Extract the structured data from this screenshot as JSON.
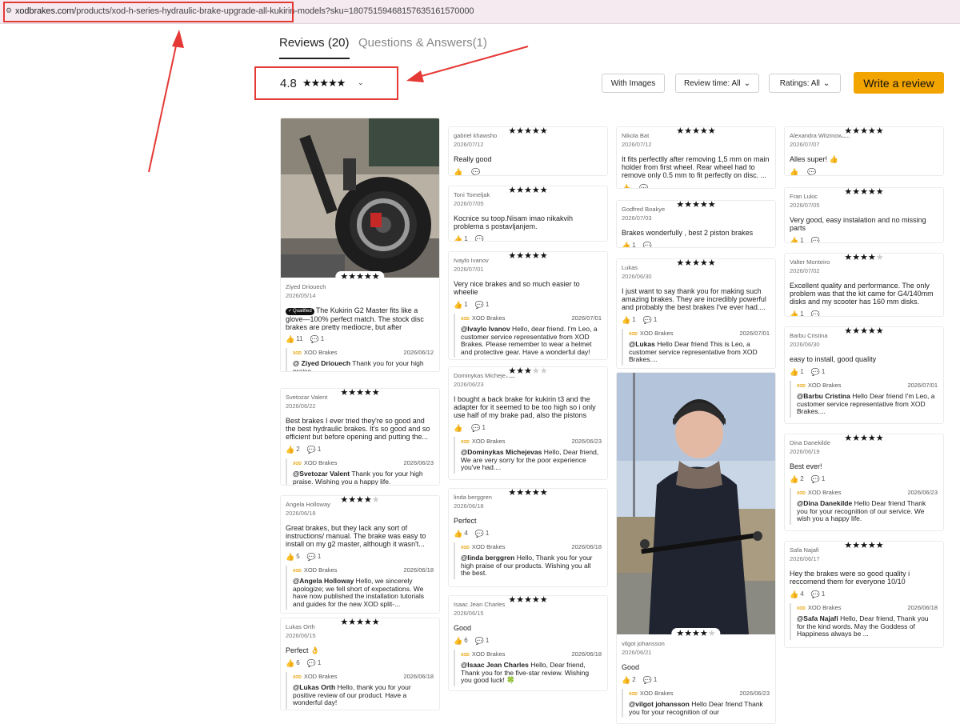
{
  "address_bar": {
    "domain": "xodbrakes.com",
    "path": "/products/xod-h-series-hydraulic-brake-upgrade-all-kukirin-models?sku=18075159468157635161570000"
  },
  "tabs": [
    {
      "label": "Reviews (20)",
      "active": true
    },
    {
      "label": "Questions & Answers(1)",
      "active": false
    }
  ],
  "rating": {
    "value": "4.8",
    "stars": 5,
    "chevron": "⌄"
  },
  "filters": {
    "with_images": "With Images",
    "review_time": "Review time: All",
    "ratings": "Ratings: All",
    "write_review": "Write a review"
  },
  "icons": {
    "star": "★",
    "thumb": "👍",
    "comment": "💬",
    "chevron": "⌄"
  },
  "brand_reply_name": "XOD Brakes",
  "columns": [
    {
      "cards": [
        {
          "stars": 5,
          "photo": "scooter-wheel-photo",
          "name": "Ziyed Driouech",
          "date": "2026/05/14",
          "qualified": "Qualified",
          "text": "The Kukirin G2 Master fits like a glove—100% perfect match. The stock disc brakes are pretty mediocre, but after upgradi...",
          "likes": "11",
          "comments": "1",
          "reply": {
            "date": "2026/06/12",
            "to": "@ Ziyed Driouech",
            "text": " Thank you for your high praise."
          }
        },
        {
          "stars": 5,
          "name": "Svetozar Valent",
          "date": "2026/06/22",
          "text": "Best brakes I ever tried they're so good and the best hydraulic brakes. It's so good and so efficient but before opening and putting the...",
          "likes": "2",
          "comments": "1",
          "reply": {
            "date": "2026/06/23",
            "to": "@Svetozar Valent",
            "text": " Thank you for your high praise. Wishing you a happy life."
          }
        },
        {
          "stars": 4,
          "name": "Angela Holloway",
          "date": "2026/06/18",
          "text": "Great brakes, but they lack any sort of instructions/ manual. The brake was easy to install on my g2 master, although it wasn't...",
          "likes": "5",
          "comments": "1",
          "reply": {
            "date": "2026/06/18",
            "to": "@Angela Holloway",
            "text": " Hello, we sincerely apologize; we fell short of expectations. We have now published the installation tutorials and guides for the new XOD split-..."
          }
        },
        {
          "stars": 5,
          "name": "Lukas Orth",
          "date": "2026/06/15",
          "text": "Perfect 👌",
          "likes": "6",
          "comments": "1",
          "reply": {
            "date": "2026/06/18",
            "to": "@Lukas Orth",
            "text": " Hello, thank you for your positive review of our product. Have a wonderful day!"
          }
        }
      ]
    },
    {
      "cards": [
        {
          "stars": 5,
          "name": "gabriel khawsho",
          "date": "2026/07/12",
          "text": "Really good",
          "likes": "",
          "comments": ""
        },
        {
          "stars": 5,
          "name": "Toni Tomeljak",
          "date": "2026/07/05",
          "text": "Kocnice su toop.Nisam imao nikakvih problema s postavljanjem.",
          "likes": "1",
          "comments": ""
        },
        {
          "stars": 5,
          "name": "Ivaylo Ivanov",
          "date": "2026/07/01",
          "text": "Very nice brakes and so much easier to wheelie",
          "likes": "1",
          "comments": "1",
          "reply": {
            "date": "2026/07/01",
            "to": "@Ivaylo Ivanov",
            "text": " Hello, dear friend. I'm Leo, a customer service representative from XOD Brakes. Please remember to wear a helmet and protective gear. Have a wonderful day!"
          }
        },
        {
          "stars": 3,
          "name": "Dominykas Michejevas",
          "date": "2026/06/23",
          "text": "I bought a back brake for kukirin t3 and the adapter for it seemed to be too high so i only use half of my brake pad, also the pistons ge...",
          "likes": "",
          "comments": "1",
          "reply": {
            "date": "2026/06/23",
            "to": "@Dominykas Michejevas",
            "text": " Hello, Dear friend, We are very sorry for the poor experience you've had...."
          }
        },
        {
          "stars": 5,
          "name": "linda berggren",
          "date": "2026/06/18",
          "text": "Perfect",
          "likes": "4",
          "comments": "1",
          "reply": {
            "date": "2026/06/18",
            "to": "@linda berggren",
            "text": " Hello, Thank you for your high praise of our products. Wishing you all the best."
          }
        },
        {
          "stars": 5,
          "name": "Isaac Jean Charles",
          "date": "2026/06/15",
          "text": "Good",
          "likes": "6",
          "comments": "1",
          "reply": {
            "date": "2026/06/18",
            "to": "@Isaac Jean Charles",
            "text": " Hello, Dear friend, Thank you for the five-star review. Wishing you good luck! 🍀"
          }
        }
      ]
    },
    {
      "cards": [
        {
          "stars": 5,
          "name": "Nikola Bat",
          "date": "2026/07/12",
          "text": "It fits perfectlly after removing 1,5 mm on main holder from first wheel. Rear wheel had to remove only 0.5 mm to fit perfectly on disc. ...",
          "likes": "",
          "comments": ""
        },
        {
          "stars": 5,
          "name": "Godfred Boakye",
          "date": "2026/07/03",
          "text": "Brakes wonderfully , best 2 piston brakes",
          "likes": "1",
          "comments": ""
        },
        {
          "stars": 5,
          "name": "Lukas",
          "date": "2026/06/30",
          "text": "I just want to say thank you for making such amazing brakes. They are incredibly powerful and probably the best brakes I've ever had....",
          "likes": "1",
          "comments": "1",
          "reply": {
            "date": "2026/07/01",
            "to": "@Lukas",
            "text": " Hello Dear friend This is Leo, a customer service representative from XOD Brakes...."
          }
        },
        {
          "stars": 4,
          "photo": "rider-helmet-photo",
          "name": "vilgot johansson",
          "date": "2026/06/21",
          "text": "Good",
          "likes": "2",
          "comments": "1",
          "reply": {
            "date": "2026/06/23",
            "to": "@vilgot johansson",
            "text": " Hello Dear friend Thank you for your recognition of our"
          }
        }
      ]
    },
    {
      "cards": [
        {
          "stars": 5,
          "name": "Alexandra Witzinowski",
          "date": "2026/07/07",
          "text": "Alles super! 👍",
          "likes": "",
          "comments": ""
        },
        {
          "stars": 5,
          "name": "Fran Lukic",
          "date": "2026/07/05",
          "text": "Very good, easy instalation and no missing parts",
          "likes": "1",
          "comments": ""
        },
        {
          "stars": 4,
          "name": "Valter Monteiro",
          "date": "2026/07/02",
          "text": "Excellent quality and performance. The only problem was that the kit came for G4/140mm disks and my scooter has 160 mm disks.",
          "likes": "1",
          "comments": ""
        },
        {
          "stars": 5,
          "name": "Barbu Cristina",
          "date": "2026/06/30",
          "text": "easy to install, good quality",
          "likes": "1",
          "comments": "1",
          "reply": {
            "date": "2026/07/01",
            "to": "@Barbu Cristina",
            "text": " Hello Dear friend I'm Leo, a customer service representative from XOD Brakes...."
          }
        },
        {
          "stars": 5,
          "name": "Dina Danekilde",
          "date": "2026/06/19",
          "text": "Best ever!",
          "likes": "2",
          "comments": "1",
          "reply": {
            "date": "2026/06/23",
            "to": "@Dina Danekilde",
            "text": " Hello Dear friend Thank you for your recognition of our service. We wish you a happy life."
          }
        },
        {
          "stars": 5,
          "name": "Safa Najafi",
          "date": "2026/06/17",
          "text": "Hey the brakes were so good quality i reccomend them for everyone 10/10",
          "likes": "4",
          "comments": "1",
          "reply": {
            "date": "2026/06/18",
            "to": "@Safa Najafi",
            "text": " Hello, Dear friend, Thank you for the kind words. May the Goddess of Happiness always be ..."
          }
        }
      ]
    }
  ]
}
